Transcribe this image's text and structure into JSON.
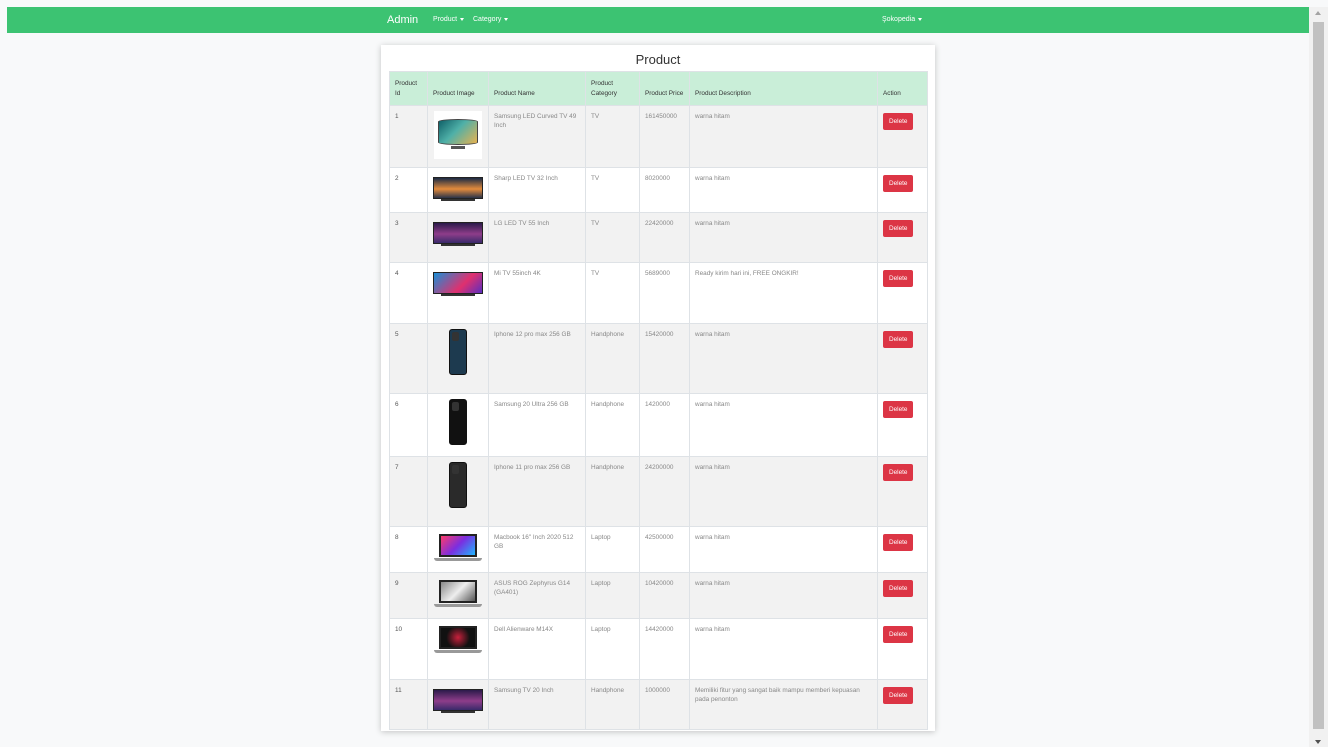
{
  "navbar": {
    "brand": "Admin",
    "product_menu": "Product",
    "category_menu": "Category",
    "store_menu": "Şokopedia",
    "color": "#3cc372"
  },
  "page": {
    "title": "Product"
  },
  "table": {
    "headers": {
      "id": "Product Id",
      "image": "Product Image",
      "name": "Product Name",
      "category": "Product Category",
      "price": "Product Price",
      "description": "Product Description",
      "action": "Action"
    },
    "delete_label": "Delete",
    "rows": [
      {
        "id": "1",
        "name": "Samsung LED Curved TV 49 Inch",
        "category": "TV",
        "price": "161450000",
        "description": "warna hitam",
        "image_icon": "curved-tv-icon"
      },
      {
        "id": "2",
        "name": "Sharp LED TV 32 Inch",
        "category": "TV",
        "price": "8020000",
        "description": "warna hitam",
        "image_icon": "tv-icon"
      },
      {
        "id": "3",
        "name": "LG LED TV 55 Inch",
        "category": "TV",
        "price": "22420000",
        "description": "warna hitam",
        "image_icon": "tv-icon"
      },
      {
        "id": "4",
        "name": "Mi TV 55inch 4K",
        "category": "TV",
        "price": "5689000",
        "description": "Ready kirim hari ini, FREE ONGKIR!",
        "image_icon": "tv-icon"
      },
      {
        "id": "5",
        "name": "Iphone 12 pro max 256 GB",
        "category": "Handphone",
        "price": "15420000",
        "description": "warna hitam",
        "image_icon": "phone-icon"
      },
      {
        "id": "6",
        "name": "Samsung 20 Ultra 256 GB",
        "category": "Handphone",
        "price": "1420000",
        "description": "warna hitam",
        "image_icon": "phone-icon"
      },
      {
        "id": "7",
        "name": "Iphone 11 pro max 256 GB",
        "category": "Handphone",
        "price": "24200000",
        "description": "warna hitam",
        "image_icon": "phone-icon"
      },
      {
        "id": "8",
        "name": "Macbook 16\" Inch 2020 512 GB",
        "category": "Laptop",
        "price": "42500000",
        "description": "warna hitam",
        "image_icon": "laptop-icon"
      },
      {
        "id": "9",
        "name": "ASUS ROG Zephyrus G14 (GA401)",
        "category": "Laptop",
        "price": "10420000",
        "description": "warna hitam",
        "image_icon": "laptop-icon"
      },
      {
        "id": "10",
        "name": "Dell Alienware M14X",
        "category": "Laptop",
        "price": "14420000",
        "description": "warna hitam",
        "image_icon": "laptop-icon"
      },
      {
        "id": "11",
        "name": "Samsung TV 20 Inch",
        "category": "Handphone",
        "price": "1000000",
        "description": "Memiliki fitur yang sangat baik mampu memberi kepuasan pada penonton",
        "image_icon": "tv-icon"
      }
    ]
  },
  "colors": {
    "header_bg": "#c9eed8",
    "delete_button": "#dc3545",
    "stripe": "#f2f2f2"
  }
}
